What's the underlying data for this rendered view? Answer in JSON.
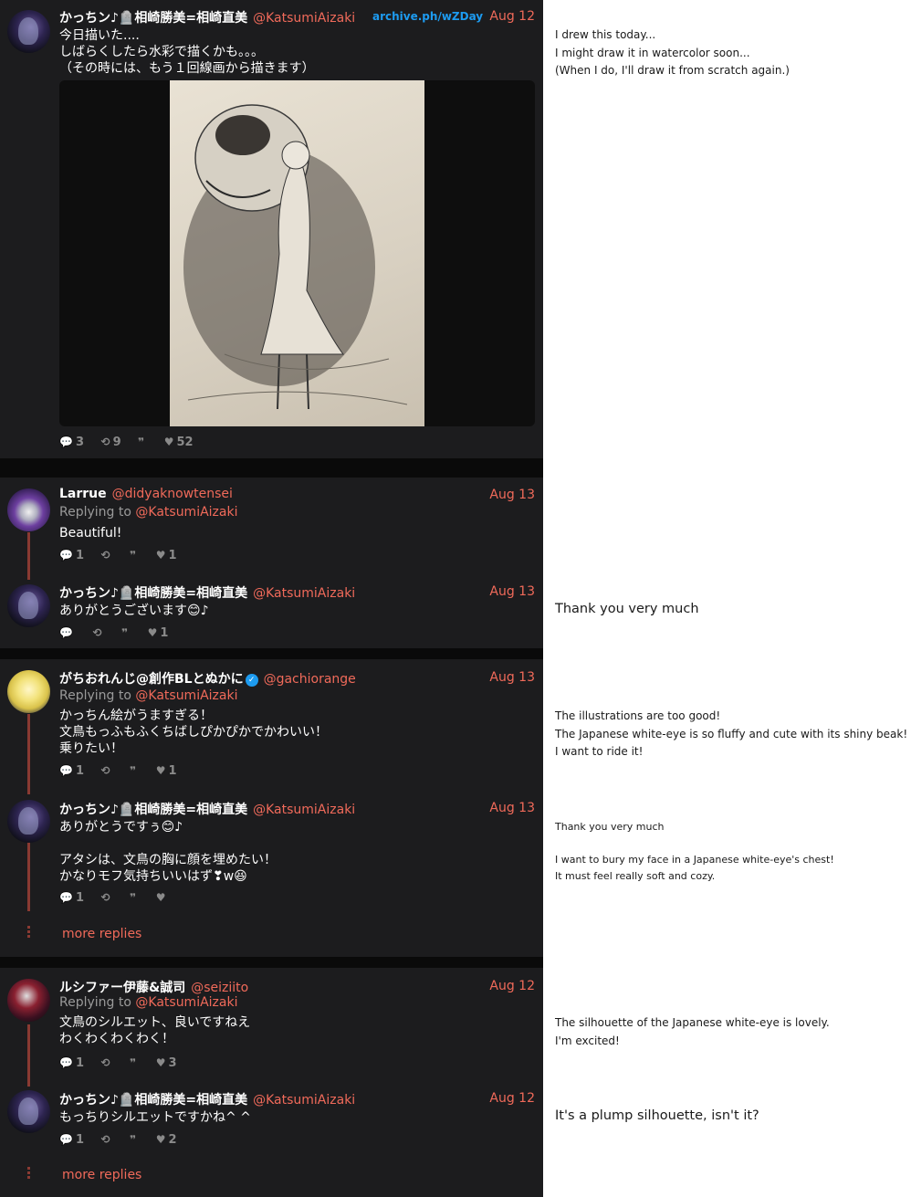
{
  "archive_link": "archive.ph/wZDay",
  "main_tweet": {
    "name": "かっちン♪🪦相崎勝美=相崎直美",
    "handle": "@KatsumiAizaki",
    "date": "Aug 12",
    "text": "今日描いた....\nしばらくしたら水彩で描くかも。。。\n（その時には、もう１回線画から描きます）",
    "stats": {
      "replies": "3",
      "retweets": "9",
      "likes": "52"
    },
    "translation": "I drew this today...\nI might draw it in watercolor soon...\n(When I do, I'll draw it from scratch again.)"
  },
  "threads": [
    {
      "tweets": [
        {
          "name": "Larrue",
          "handle": "@didyaknowtensei",
          "date": "Aug 13",
          "replying_to": "@KatsumiAizaki",
          "replying_label": "Replying to ",
          "text": "Beautiful!",
          "stats": {
            "replies": "1",
            "retweets": "",
            "likes": "1"
          }
        },
        {
          "name": "かっちン♪🪦相崎勝美=相崎直美",
          "handle": "@KatsumiAizaki",
          "date": "Aug 13",
          "text": "ありがとうございます😊♪",
          "stats": {
            "replies": "",
            "retweets": "",
            "likes": "1"
          },
          "translation": "Thank you very much"
        }
      ]
    },
    {
      "tweets": [
        {
          "name": "がちおれんじ@創作BLとぬかに",
          "handle": "@gachiorange",
          "date": "Aug 13",
          "replying_to": "@KatsumiAizaki",
          "replying_label": "Replying to ",
          "text": "かっちん絵がうますぎる！\n文鳥もっふもふくちばしぴかぴかでかわいい！\n乗りたい！",
          "stats": {
            "replies": "1",
            "retweets": "",
            "likes": "1"
          },
          "translation": "The illustrations are too good!\nThe Japanese white-eye is so fluffy and cute with its shiny beak!\nI want to ride it!"
        },
        {
          "name": "かっちン♪🪦相崎勝美=相崎直美",
          "handle": "@KatsumiAizaki",
          "date": "Aug 13",
          "text": "ありがとうですぅ😊♪\n\nアタシは、文鳥の胸に顔を埋めたい！\nかなりモフ気持ちいいはず❣w😆",
          "stats": {
            "replies": "1",
            "retweets": "",
            "likes": ""
          },
          "translation": "Thank you very much\n\nI want to bury my face in a Japanese white-eye's chest!\nIt must feel really soft and cozy."
        }
      ],
      "more": "more replies"
    },
    {
      "tweets": [
        {
          "name": "ルシファー伊藤&誠司",
          "handle": "@seiziito",
          "date": "Aug 12",
          "replying_to": "@KatsumiAizaki",
          "replying_label": "Replying to ",
          "text": "文鳥のシルエット、良いですねえ\nわくわくわくわく！",
          "stats": {
            "replies": "1",
            "retweets": "",
            "likes": "3"
          },
          "translation": "The silhouette of the Japanese white-eye is lovely.\nI'm excited!"
        },
        {
          "name": "かっちン♪🪦相崎勝美=相崎直美",
          "handle": "@KatsumiAizaki",
          "date": "Aug 12",
          "text": "もっちりシルエットですかね^ ^",
          "stats": {
            "replies": "1",
            "retweets": "",
            "likes": "2"
          },
          "translation": "It's a plump silhouette, isn't it?"
        }
      ],
      "more": "more replies"
    }
  ],
  "icons": {
    "reply": "💬",
    "retweet": "⟲",
    "quote": "❞",
    "like": "♥"
  }
}
